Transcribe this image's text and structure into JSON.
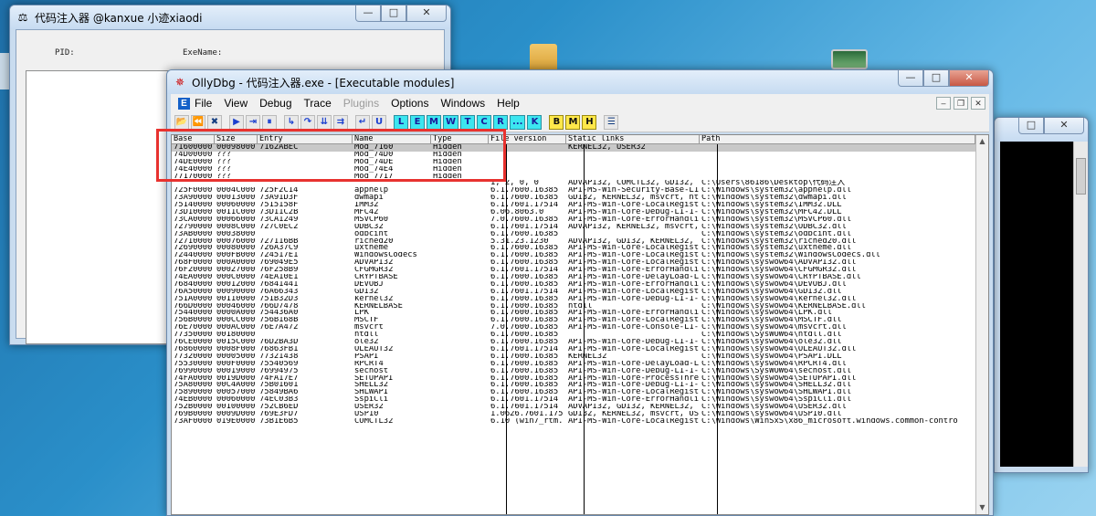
{
  "injector": {
    "title": "代码注入器 @kanxue 小迹xiaodi",
    "pid_label": "PID:",
    "exename_label": "ExeName:"
  },
  "olly": {
    "title": "OllyDbg - 代码注入器.exe - [Executable modules]",
    "menu": [
      {
        "label": "File",
        "enabled": true
      },
      {
        "label": "View",
        "enabled": true
      },
      {
        "label": "Debug",
        "enabled": true
      },
      {
        "label": "Trace",
        "enabled": true
      },
      {
        "label": "Plugins",
        "enabled": false
      },
      {
        "label": "Options",
        "enabled": true
      },
      {
        "label": "Windows",
        "enabled": true
      },
      {
        "label": "Help",
        "enabled": true
      }
    ],
    "toolbar_letters": [
      "L",
      "E",
      "M",
      "W",
      "T",
      "C",
      "R",
      "...",
      "K"
    ],
    "toolbar_letters2": [
      "B",
      "M",
      "H"
    ],
    "columns": [
      "Base",
      "Size",
      "Entry",
      "Name",
      "Type",
      "File version",
      "Static links",
      "Path"
    ],
    "rows": [
      [
        "71600000",
        "00098000",
        "7162ABEC",
        "Mod_7160",
        "Hidden",
        "",
        "KERNEL32, USER32",
        ""
      ],
      [
        "74D00000",
        "???",
        "",
        "Mod_74D0",
        "Hidden",
        "",
        "",
        ""
      ],
      [
        "74DE0000",
        "???",
        "",
        "Mod_74DE",
        "Hidden",
        "",
        "",
        ""
      ],
      [
        "74E40000",
        "???",
        "",
        "Mod_74E4",
        "Hidden",
        "",
        "",
        ""
      ],
      [
        "77170000",
        "???",
        "",
        "Mod_7717",
        "Hidden",
        "",
        "",
        ""
      ],
      [
        "",
        "",
        "",
        "",
        "",
        "1, 2, 0, 0",
        "ADVAPI32, COMCTL32, GDI32,",
        "C:\\Users\\86186\\Desktop\\代码注入"
      ],
      [
        "725F0000",
        "0004C000",
        "725F2C14",
        "apphelp",
        "",
        "6.1.7600.16385",
        "API-MS-Win-Security-Base-L1",
        "C:\\Windows\\system32\\apphelp.dll"
      ],
      [
        "73A90000",
        "00013000",
        "73A91D3F",
        "dwmapi",
        "",
        "6.1.7600.16385",
        "GDI32, KERNEL32, msvcrt, nt",
        "C:\\Windows\\system32\\dwmapi.dll"
      ],
      [
        "75140000",
        "00060000",
        "7515158F",
        "IMM32",
        "",
        "6.1.7601.17514",
        "API-MS-Win-Core-LocalRegist",
        "C:\\Windows\\system32\\IMM32.DLL"
      ],
      [
        "73D10000",
        "0011C000",
        "73D11C2B",
        "MFC42",
        "",
        "6.06.8063.0",
        "API-MS-Win-Core-Debug-L1-1-",
        "C:\\Windows\\system32\\MFC42.DLL"
      ],
      [
        "73CA0000",
        "00066000",
        "73CA1249",
        "MSVCP60",
        "",
        "7.0.7600.16385",
        "API-MS-Win-Core-ErrorHandli",
        "C:\\Windows\\system32\\MSVCP60.dll"
      ],
      [
        "72790000",
        "0008C000",
        "727C0EC2",
        "ODBC32",
        "",
        "6.1.7601.17514",
        "ADVAPI32, KERNEL32, msvcrt,",
        "C:\\Windows\\system32\\ODBC32.dll"
      ],
      [
        "73AB0000",
        "00038000",
        "",
        "odbcint",
        "",
        "6.1.7600.16385",
        "",
        "C:\\Windows\\system32\\odbcint.dll"
      ],
      [
        "72710000",
        "00076000",
        "727116BB",
        "riched20",
        "",
        "5.31.23.1230",
        "ADVAPI32, GDI32, KERNEL32,",
        "C:\\Windows\\system32\\riched20.dll"
      ],
      [
        "72690000",
        "00080000",
        "726A37C9",
        "uxtheme",
        "",
        "6.1.7600.16385",
        "API-MS-Win-Core-LocalRegist",
        "C:\\Windows\\system32\\uxtheme.dll"
      ],
      [
        "72440000",
        "000FB000",
        "724517E1",
        "WindowsCodecs",
        "",
        "6.1.7600.16385",
        "API-MS-Win-Core-LocalRegist",
        "C:\\Windows\\system32\\WindowsCodecs.dll"
      ],
      [
        "768F0000",
        "000A0000",
        "769049E5",
        "ADVAPI32",
        "",
        "6.1.7600.16385",
        "API-MS-Win-Core-LocalRegist",
        "C:\\Windows\\syswow64\\ADVAPI32.dll"
      ],
      [
        "76F20000",
        "00027000",
        "76F258B9",
        "CFGMGR32",
        "",
        "6.1.7601.17514",
        "API-MS-Win-Core-ErrorHandli",
        "C:\\Windows\\syswow64\\CFGMGR32.dll"
      ],
      [
        "74EA0000",
        "000C0000",
        "74EA10E1",
        "CRYPTBASE",
        "",
        "6.1.7600.16385",
        "API-MS-Win-Core-DelayLoad-L",
        "C:\\Windows\\syswow64\\CRYPTBASE.dll"
      ],
      [
        "76840000",
        "00012000",
        "76841441",
        "DEVOBJ",
        "",
        "6.1.7600.16385",
        "API-MS-Win-Core-ErrorHandli",
        "C:\\Windows\\syswow64\\DEVOBJ.dll"
      ],
      [
        "76A50000",
        "00090000",
        "76A66343",
        "GDI32",
        "",
        "6.1.7601.17514",
        "API-MS-Win-Core-LocalRegist",
        "C:\\Windows\\syswow64\\GDI32.dll"
      ],
      [
        "751A0000",
        "00110000",
        "751B32D3",
        "kernel32",
        "",
        "6.1.7600.16385",
        "API-MS-Win-Core-Debug-L1-1-",
        "C:\\Windows\\syswow64\\kernel32.dll"
      ],
      [
        "766D0000",
        "00046000",
        "766D7478",
        "KERNELBASE",
        "",
        "6.1.7600.16385",
        "ntdll",
        "C:\\Windows\\syswow64\\KERNELBASE.dll"
      ],
      [
        "75440000",
        "0000A000",
        "754436A0",
        "LPK",
        "",
        "6.1.7600.16385",
        "API-MS-Win-Core-ErrorHandli",
        "C:\\Windows\\syswow64\\LPK.dll"
      ],
      [
        "756B0000",
        "000CC000",
        "756B168B",
        "MSCTF",
        "",
        "6.1.7600.16385",
        "API-MS-Win-Core-LocalRegist",
        "C:\\Windows\\syswow64\\MSCTF.dll"
      ],
      [
        "76E70000",
        "000AC000",
        "76E7A472",
        "msvcrt",
        "",
        "7.0.7600.16385",
        "API-MS-Win-Core-Console-L1-",
        "C:\\Windows\\syswow64\\msvcrt.dll"
      ],
      [
        "77350000",
        "00180000",
        "",
        "ntdll",
        "",
        "6.1.7600.16385",
        "",
        "C:\\Windows\\SysWOW64\\ntdll.dll"
      ],
      [
        "76CE0000",
        "0015C000",
        "76D2BA3D",
        "ole32",
        "",
        "6.1.7600.16385",
        "API-MS-Win-Core-Debug-L1-1-",
        "C:\\Windows\\syswow64\\ole32.dll"
      ],
      [
        "76860000",
        "0008F000",
        "76863FB1",
        "OLEAUT32",
        "",
        "6.1.7601.17514",
        "API-MS-Win-Core-LocalRegist",
        "C:\\Windows\\syswow64\\OLEAUT32.dll"
      ],
      [
        "77320000",
        "00005000",
        "77321438",
        "PSAPI",
        "",
        "6.1.7600.16385",
        "KERNEL32",
        "C:\\Windows\\syswow64\\PSAPI.DLL"
      ],
      [
        "75530000",
        "000F0000",
        "75540569",
        "RPCRT4",
        "",
        "6.1.7600.16385",
        "API-MS-Win-Core-DelayLoad-L",
        "C:\\Windows\\syswow64\\RPCRT4.dll"
      ],
      [
        "76990000",
        "00019000",
        "76994975",
        "sechost",
        "",
        "6.1.7600.16385",
        "API-MS-Win-Core-Debug-L1-1-",
        "C:\\Windows\\SysWOW64\\sechost.dll"
      ],
      [
        "74FA0000",
        "0019D000",
        "74FA17E7",
        "SETUPAPI",
        "",
        "6.1.7600.16385",
        "API-MS-Win-Core-ProcessThre",
        "C:\\Windows\\syswow64\\SETUPAPI.dll"
      ],
      [
        "75A80000",
        "00C4A000",
        "75B01601",
        "SHELL32",
        "",
        "6.1.7600.16385",
        "API-MS-Win-Core-Debug-L1-1-",
        "C:\\Windows\\syswow64\\SHELL32.dll"
      ],
      [
        "75890000",
        "00057000",
        "75849BA6",
        "SHLWAPI",
        "",
        "6.1.7600.16385",
        "API-MS-Win-Core-LocalRegist",
        "C:\\Windows\\syswow64\\SHLWAPI.dll"
      ],
      [
        "74EB0000",
        "00060000",
        "74EC03B3",
        "SspiCli",
        "",
        "6.1.7601.17514",
        "API-MS-Win-Core-ErrorHandli",
        "C:\\Windows\\syswow64\\SspiCli.dll"
      ],
      [
        "752B0000",
        "00100000",
        "752CB6ED",
        "USER32",
        "",
        "6.1.7601.17514",
        "ADVAPI32, GDI32, KERNEL32,",
        "C:\\Windows\\syswow64\\USER32.dll"
      ],
      [
        "769B0000",
        "0009D000",
        "769E3FD7",
        "USP10",
        "",
        "1.0626.7601.175",
        "GDI32, KERNEL32, msvcrt, US",
        "C:\\Windows\\syswow64\\USP10.dll"
      ],
      [
        "73AF0000",
        "019E0000",
        "73B1E6B5",
        "COMCTL32",
        "",
        "6.10 (win7_rtm.",
        "API-MS-Win-Core-LocalRegist",
        "C:\\Windows\\WinSxS\\x86_microsoft.windows.common-contro"
      ]
    ]
  },
  "colors": {
    "highlight_box": "#e8322f",
    "selected_row": "#c8c8c8"
  }
}
